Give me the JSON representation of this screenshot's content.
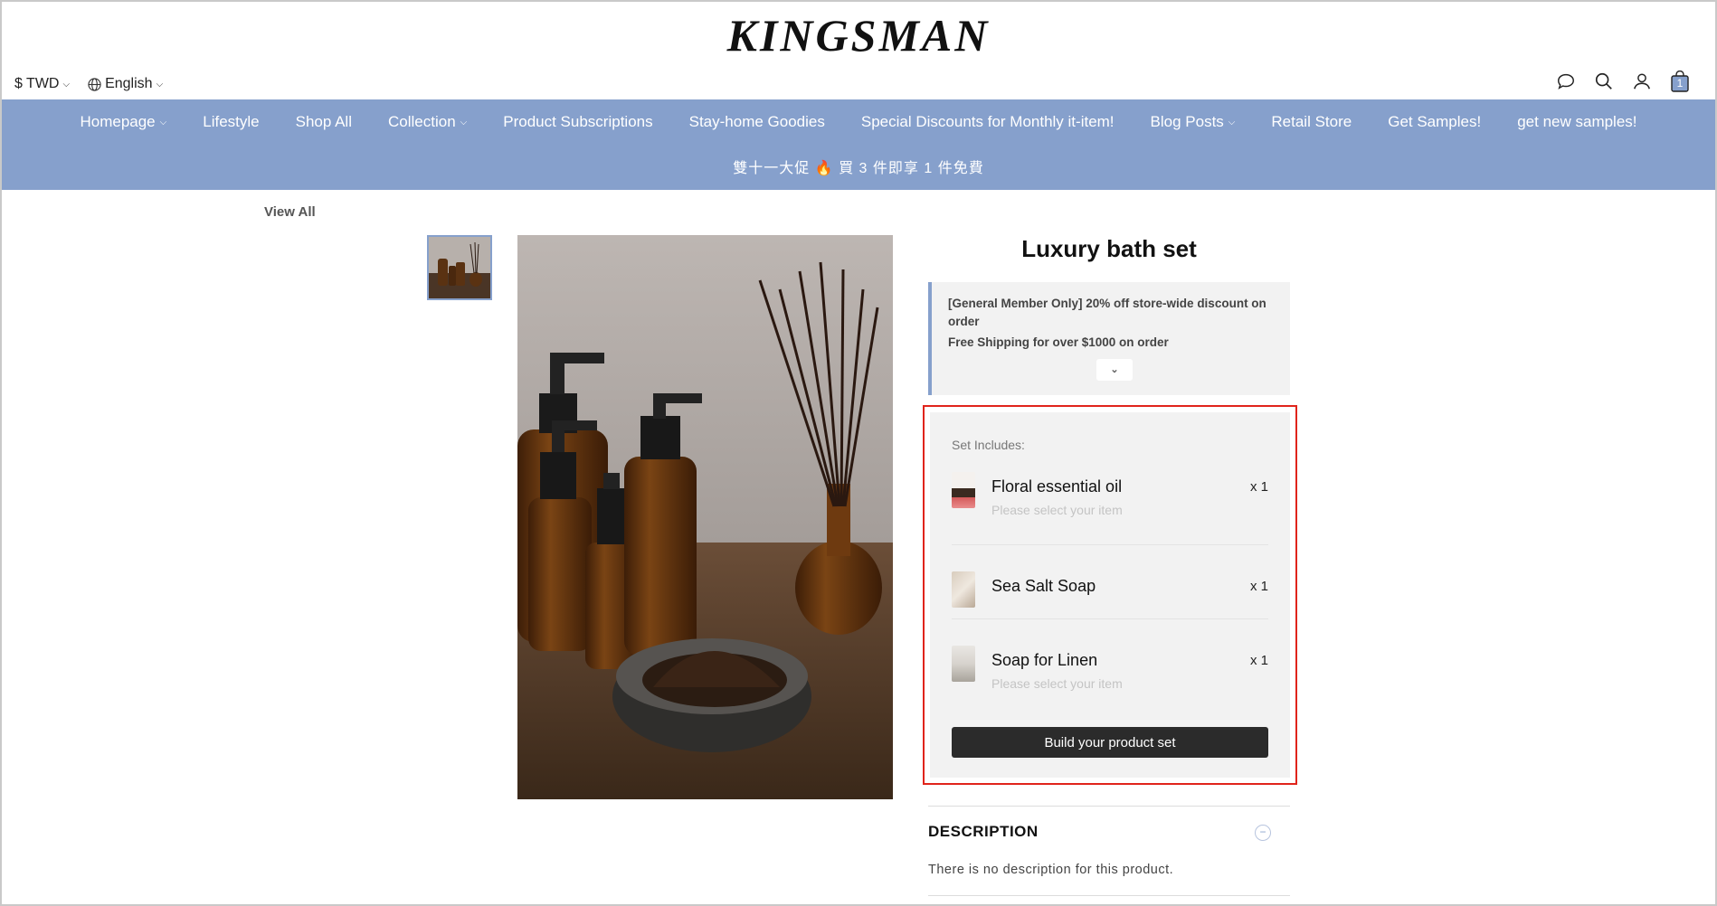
{
  "header": {
    "logo": "KINGSMAN",
    "currency": "$ TWD",
    "language": "English"
  },
  "nav": {
    "items": [
      {
        "label": "Homepage",
        "dropdown": true
      },
      {
        "label": "Lifestyle",
        "dropdown": false
      },
      {
        "label": "Shop All",
        "dropdown": false
      },
      {
        "label": "Collection",
        "dropdown": true
      },
      {
        "label": "Product Subscriptions",
        "dropdown": false
      },
      {
        "label": "Stay-home Goodies",
        "dropdown": false
      },
      {
        "label": "Special Discounts for Monthly it-item!",
        "dropdown": false
      },
      {
        "label": "Blog Posts",
        "dropdown": true
      },
      {
        "label": "Retail Store",
        "dropdown": false
      },
      {
        "label": "Get Samples!",
        "dropdown": false
      },
      {
        "label": "get new samples!",
        "dropdown": false
      }
    ],
    "promo_banner": "雙十一大促 🔥 買 3 件即享 1 件免費",
    "accent_color": "#86a0cc"
  },
  "cart": {
    "count": "1"
  },
  "breadcrumb": {
    "view_all": "View All"
  },
  "product": {
    "title": "Luxury bath set",
    "promotions": [
      "[General Member Only] 20% off store-wide discount on order",
      "Free Shipping for over $1000 on order"
    ],
    "set": {
      "label": "Set Includes:",
      "items": [
        {
          "name": "Floral essential oil",
          "qty": "x 1",
          "hint": "Please select your item"
        },
        {
          "name": "Sea Salt Soap",
          "qty": "x 1",
          "hint": ""
        },
        {
          "name": "Soap for Linen",
          "qty": "x 1",
          "hint": "Please select your item"
        }
      ],
      "build_button": "Build your product set"
    },
    "description": {
      "title": "DESCRIPTION",
      "text": "There is no description for this product."
    }
  },
  "highlight_color": "#e0241b"
}
